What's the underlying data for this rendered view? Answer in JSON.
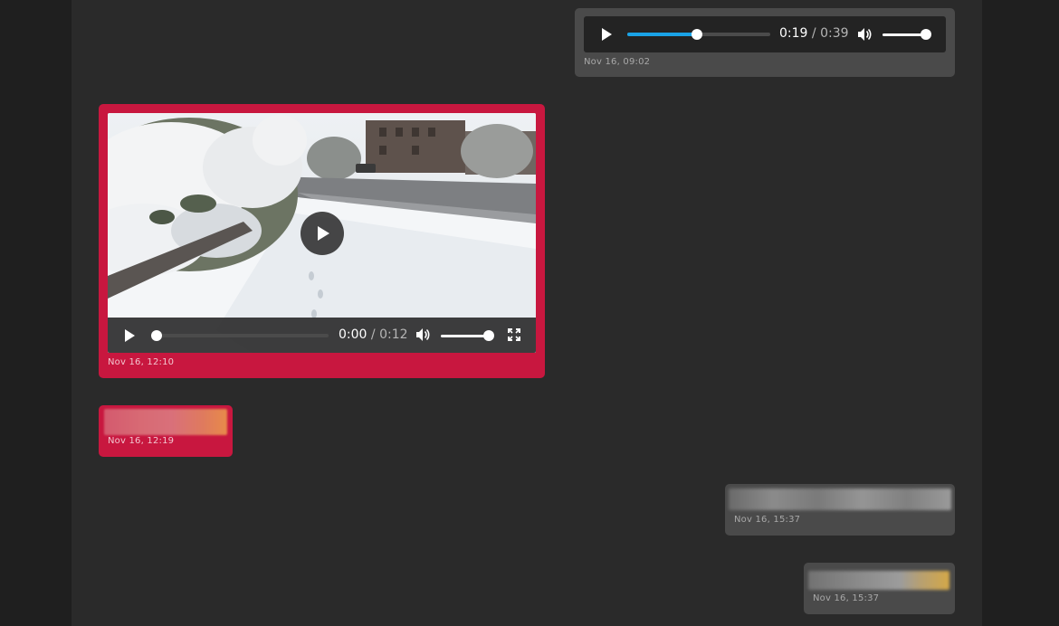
{
  "messages": [
    {
      "id": "audio-msg",
      "kind": "audio",
      "player": {
        "current_time": "0:19",
        "separator": "/",
        "duration": "0:39",
        "progress_fraction": 0.49,
        "volume_fraction": 1.0,
        "icons": [
          "play-icon",
          "volume-icon"
        ]
      },
      "timestamp": "Nov 16, 09:02"
    },
    {
      "id": "video-msg",
      "kind": "video",
      "player": {
        "current_time": "0:00",
        "separator": "/",
        "duration": "0:12",
        "progress_fraction": 0.0,
        "volume_fraction": 1.0,
        "icons": [
          "play-icon",
          "big-play-icon",
          "volume-icon",
          "fullscreen-icon"
        ]
      },
      "timestamp": "Nov 16, 12:10"
    },
    {
      "id": "blurred-in",
      "kind": "blurred-preview",
      "timestamp": "Nov 16, 12:19"
    },
    {
      "id": "blurred-out-1",
      "kind": "blurred-preview",
      "timestamp": "Nov 16, 15:37"
    },
    {
      "id": "blurred-out-2",
      "kind": "blurred-preview",
      "timestamp": "Nov 16, 15:37"
    }
  ],
  "colors": {
    "page_background": "#1f1f1f",
    "chat_background": "#2a2a2a",
    "outgoing_bubble": "#4a4a4a",
    "incoming_bubble": "#c8173f",
    "progress_accent": "#1aa3e6"
  }
}
